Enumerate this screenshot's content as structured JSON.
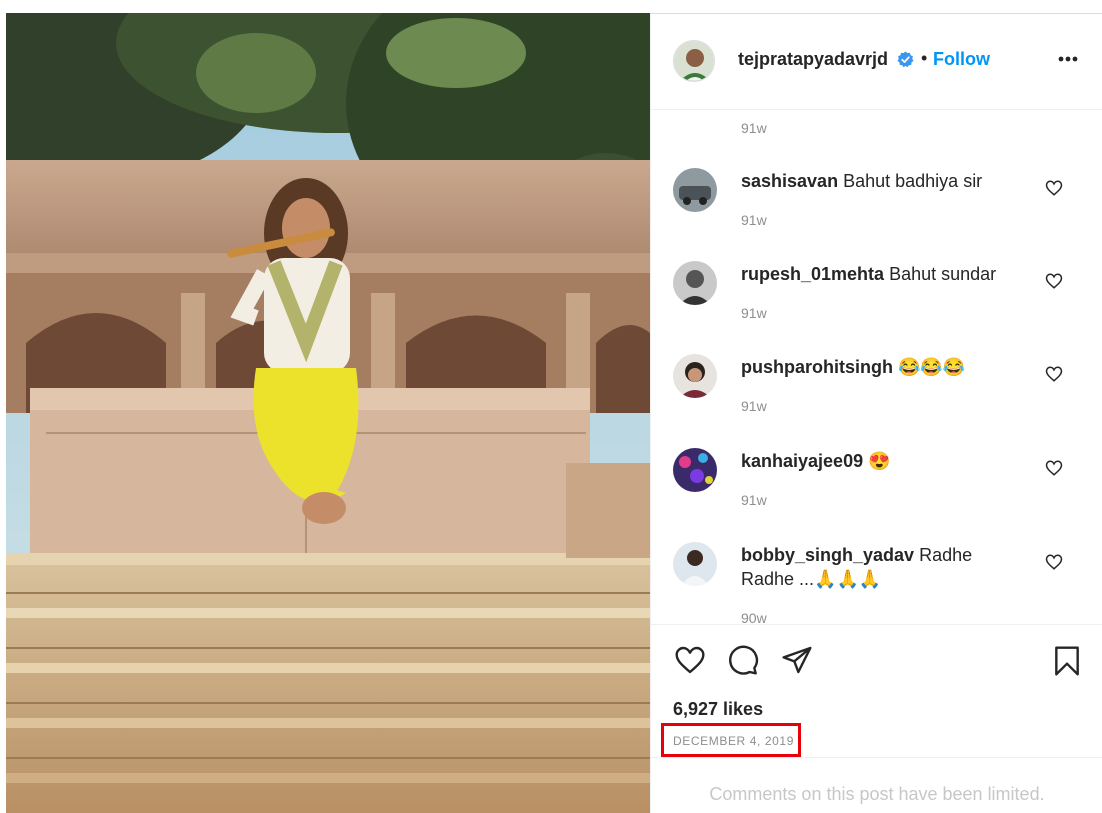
{
  "post": {
    "username": "tejpratapyadavrjd",
    "dot": "•",
    "follow_label": "Follow",
    "top_comment_time": "91w"
  },
  "comments": [
    {
      "user": "sashisavan",
      "text": "Bahut badhiya sir",
      "time": "91w"
    },
    {
      "user": "rupesh_01mehta",
      "text": "Bahut sundar",
      "time": "91w"
    },
    {
      "user": "pushparohitsingh",
      "text": "😂😂😂",
      "time": "91w"
    },
    {
      "user": "kanhaiyajee09",
      "text": "😍",
      "time": "91w"
    },
    {
      "user": "bobby_singh_yadav",
      "text": "Radhe Radhe ...🙏🙏🙏",
      "time": "90w"
    }
  ],
  "stats": {
    "likes": "6,927 likes",
    "date": "DECEMBER 4, 2019"
  },
  "footer": {
    "limited_text": "Comments on this post have been limited."
  },
  "icons": {
    "like": "heart-icon",
    "comment": "comment-icon",
    "share": "share-icon",
    "save": "bookmark-icon",
    "more": "more-options-icon",
    "verified": "verified-badge-icon"
  },
  "colors": {
    "accent": "#0095f6",
    "verified": "#3897f0",
    "highlight_box": "#e8000b",
    "muted": "#8e8e8e"
  }
}
